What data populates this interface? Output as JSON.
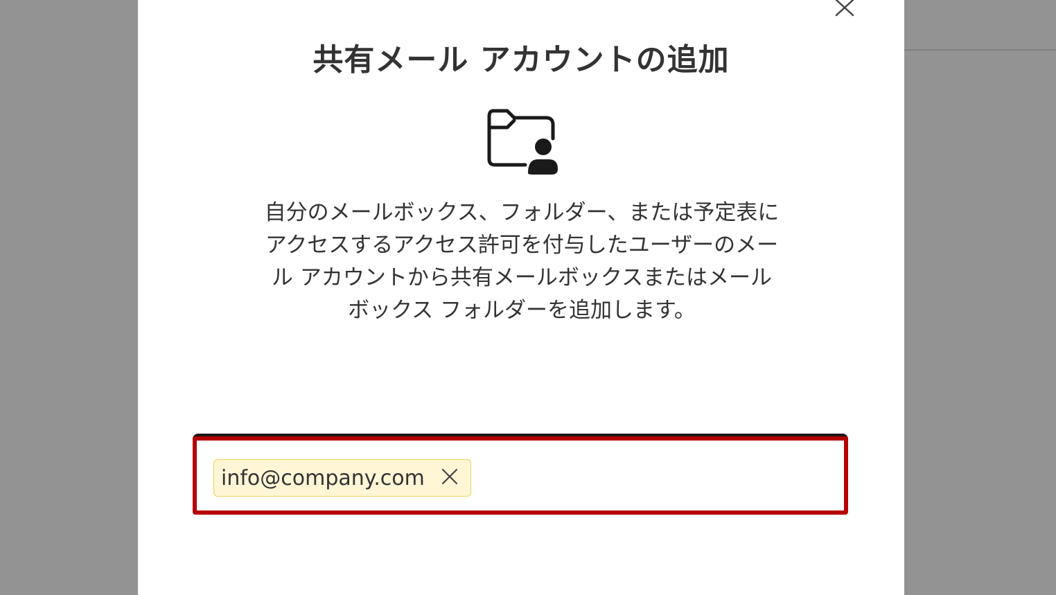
{
  "dialog": {
    "title": "共有メール アカウントの追加",
    "description": "自分のメールボックス、フォルダー、または予定表にアクセスするアクセス許可を付与したユーザーのメール アカウントから共有メールボックスまたはメールボックス フォルダーを追加します。",
    "close_icon": "close-icon",
    "illustration_icon": "shared-folder-person-icon"
  },
  "recipient_field": {
    "chips": [
      {
        "label": "info@company.com",
        "remove_icon": "close-icon"
      }
    ],
    "highlight_color": "#b40000",
    "chip_background": "#fff6d6",
    "chip_border": "#f2cf5b"
  },
  "colors": {
    "backdrop": "#939393",
    "dialog_background": "#ffffff",
    "text": "#333333"
  }
}
